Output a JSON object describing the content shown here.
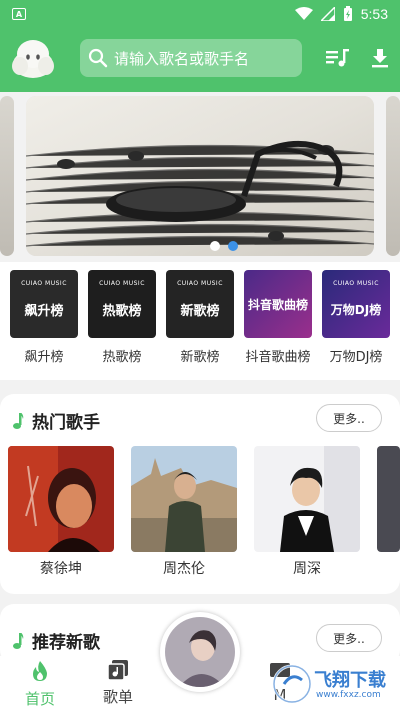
{
  "statusbar": {
    "time": "5:53",
    "left_badge": "A"
  },
  "search": {
    "placeholder": "请输入歌名或歌手名"
  },
  "banner": {
    "active_dot": 1,
    "dot_count": 2
  },
  "charts": [
    {
      "label": "飙升榜",
      "cover_text": "飙升榜",
      "brand": "CUIAO MUSIC",
      "color": "#2a2a2a"
    },
    {
      "label": "热歌榜",
      "cover_text": "热歌榜",
      "brand": "CUIAO MUSIC",
      "color": "#1e1e1e"
    },
    {
      "label": "新歌榜",
      "cover_text": "新歌榜",
      "brand": "CUIAO MUSIC",
      "color": "#242424"
    },
    {
      "label": "抖音歌曲榜",
      "cover_text": "抖音歌曲榜",
      "brand": "",
      "color": "#6b2a8c"
    },
    {
      "label": "万物DJ榜",
      "cover_text": "万物DJ榜",
      "brand": "CUIAO MUSIC",
      "color": "#3a2a7a"
    }
  ],
  "hot_artists": {
    "title": "热门歌手",
    "more": "更多..",
    "items": [
      {
        "name": "蔡徐坤"
      },
      {
        "name": "周杰伦"
      },
      {
        "name": "周深"
      }
    ]
  },
  "new_songs": {
    "title": "推荐新歌",
    "more": "更多.."
  },
  "nav": {
    "home": "首页",
    "playlist": "歌单",
    "partial": "M"
  },
  "watermark": {
    "text": "飞翔下载",
    "sub": "www.fxxz.com"
  },
  "colors": {
    "primary": "#4fc26c",
    "search_bg": "#86d59a",
    "dot_active": "#3b91e8"
  }
}
